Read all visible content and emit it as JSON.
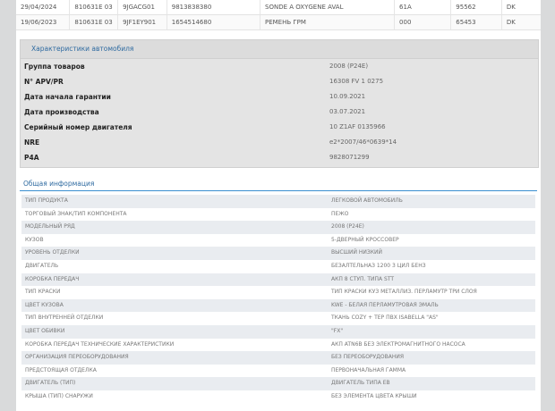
{
  "history": [
    [
      "29/04/2024",
      "810631E 03",
      "9JGACG01",
      "9813838380",
      "SONDE A OXYGENE AVAL",
      "61A",
      "95562",
      "DK"
    ],
    [
      "19/06/2023",
      "810631E 03",
      "9JF1EY901",
      "1654514680",
      "РЕМЕНЬ ГРМ",
      "000",
      "65453",
      "DK"
    ]
  ],
  "characteristics": {
    "title": "Характеристики автомобиля",
    "rows": [
      {
        "label": "Группа товаров",
        "value": "2008 (P24E)"
      },
      {
        "label": "N° APV/PR",
        "value": "16308 FV 1 0275"
      },
      {
        "label": "Дата начала гарантии",
        "value": "10.09.2021"
      },
      {
        "label": "Дата производства",
        "value": "03.07.2021"
      },
      {
        "label": "Серийный номер двигателя",
        "value": "10 Z1AF 0135966"
      },
      {
        "label": "NRE",
        "value": "e2*2007/46*0639*14"
      },
      {
        "label": "P4A",
        "value": "9828071299"
      }
    ]
  },
  "general": {
    "title": "Общая информация",
    "rows": [
      {
        "label": "ТИП ПРОДУКТА",
        "value": "ЛЕГКОВОЙ АВТОМОБИЛЬ"
      },
      {
        "label": "ТОРГОВЫЙ ЗНАК/ТИП КОМПОНЕНТА",
        "value": "ПЕЖО"
      },
      {
        "label": "МОДЕЛЬНЫЙ РЯД",
        "value": "2008 (P24E)"
      },
      {
        "label": "КУЗОВ",
        "value": "5-ДВЕРНЫЙ КРОССОВЕР"
      },
      {
        "label": "УРОВЕНЬ ОТДЕЛКИ",
        "value": "ВЫСШИЙ НИЗКИЙ"
      },
      {
        "label": "ДВИГАТЕЛЬ",
        "value": "БЕЗАЛТЕЛЬНАЗ 1200 3 ЦИЛ БЕНЗ"
      },
      {
        "label": "КОРОБКА ПЕРЕДАЧ",
        "value": "АКП 8 СТУП. ТИПА STT"
      },
      {
        "label": "ТИП КРАСКИ",
        "value": "ТИП КРАСКИ КУЗ МЕТАЛЛИЗ. ПЕРЛАМУТР ТРИ СЛОЯ"
      },
      {
        "label": "ЦВЕТ КУЗОВА",
        "value": "KWE - БЕЛАЯ ПЕРЛАМУТРОВАЯ ЭМАЛЬ"
      },
      {
        "label": "ТИП ВНУТРЕННЕЙ ОТДЕЛКИ",
        "value": "ТКАНЬ COZY + TEP ПВХ ISABELLA \"AS\""
      },
      {
        "label": "ЦВЕТ ОБИВКИ",
        "value": "\"FX\""
      },
      {
        "label": "КОРОБКА ПЕРЕДАЧ ТЕХНИЧЕСКИЕ ХАРАКТЕРИСТИКИ",
        "value": "АКП ATN6B БЕЗ ЭЛЕКТРОМАГНИТНОГО НАСОСА"
      },
      {
        "label": "ОРГАНИЗАЦИЯ ПЕРЕОБОРУДОВАНИЯ",
        "value": "БЕЗ ПЕРЕОБОРУДОВАНИЯ"
      },
      {
        "label": "ПРЕДСТОЯЩАЯ ОТДЕЛКА",
        "value": "ПЕРВОНАЧАЛЬНАЯ ГАММА"
      },
      {
        "label": "ДВИГАТЕЛЬ (ТИП)",
        "value": "ДВИГАТЕЛЬ ТИПА EB"
      },
      {
        "label": "КРЫША (ТИП) СНАРУЖИ",
        "value": "БЕЗ ЭЛЕМЕНТА ЦВЕТА КРЫШИ"
      }
    ]
  }
}
